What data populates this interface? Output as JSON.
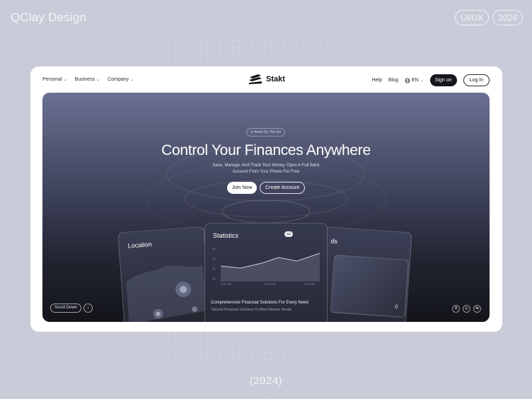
{
  "brand": "QClay Design",
  "pills": [
    "UI/UX",
    "2024"
  ],
  "footer_year": "(2024)",
  "site": {
    "nav": {
      "left": [
        {
          "label": "Personal",
          "icon": "chevron-down-icon"
        },
        {
          "label": "Business",
          "icon": "chevron-down-icon"
        },
        {
          "label": "Company",
          "icon": "chevron-down-icon"
        }
      ],
      "logo_text": "Stakt",
      "help": "Help",
      "blog": "Blog",
      "language": "EN",
      "signup": "Sign un",
      "login": "Log In"
    },
    "hero": {
      "badge": "Bank On The Go",
      "title": "Control Your Finances Anywhere",
      "subtitle_line1": "Save, Manage, And Track Your Money. Open A Full Bank",
      "subtitle_line2": "Account From Your Phone For Free",
      "join_button": "Join Now",
      "create_button": "Create Account",
      "scroll_label": "Scroll Down",
      "socials": [
        "x-icon",
        "instagram-icon",
        "linkedin-icon"
      ]
    },
    "cards": {
      "location_title": "Location",
      "cards_title_fragment": "ds",
      "statistics": {
        "title": "Statistics",
        "toggle_label": "1W",
        "y_ticks": [
          "40",
          "30",
          "20",
          "10"
        ],
        "x_ticks": [
          "9:00 PM",
          "6:00 PM",
          "3:00 PM"
        ],
        "footer_title": "Comprehensive Financial Solutions For Every Need",
        "footer_sub": "Tailored Financial Solutions To Meet Diverse Needs"
      }
    }
  },
  "colors": {
    "page_bg": "#c9cbd8",
    "hero_top": "#6a7091",
    "hero_bottom": "#14151b",
    "dark_button": "#16171b"
  }
}
